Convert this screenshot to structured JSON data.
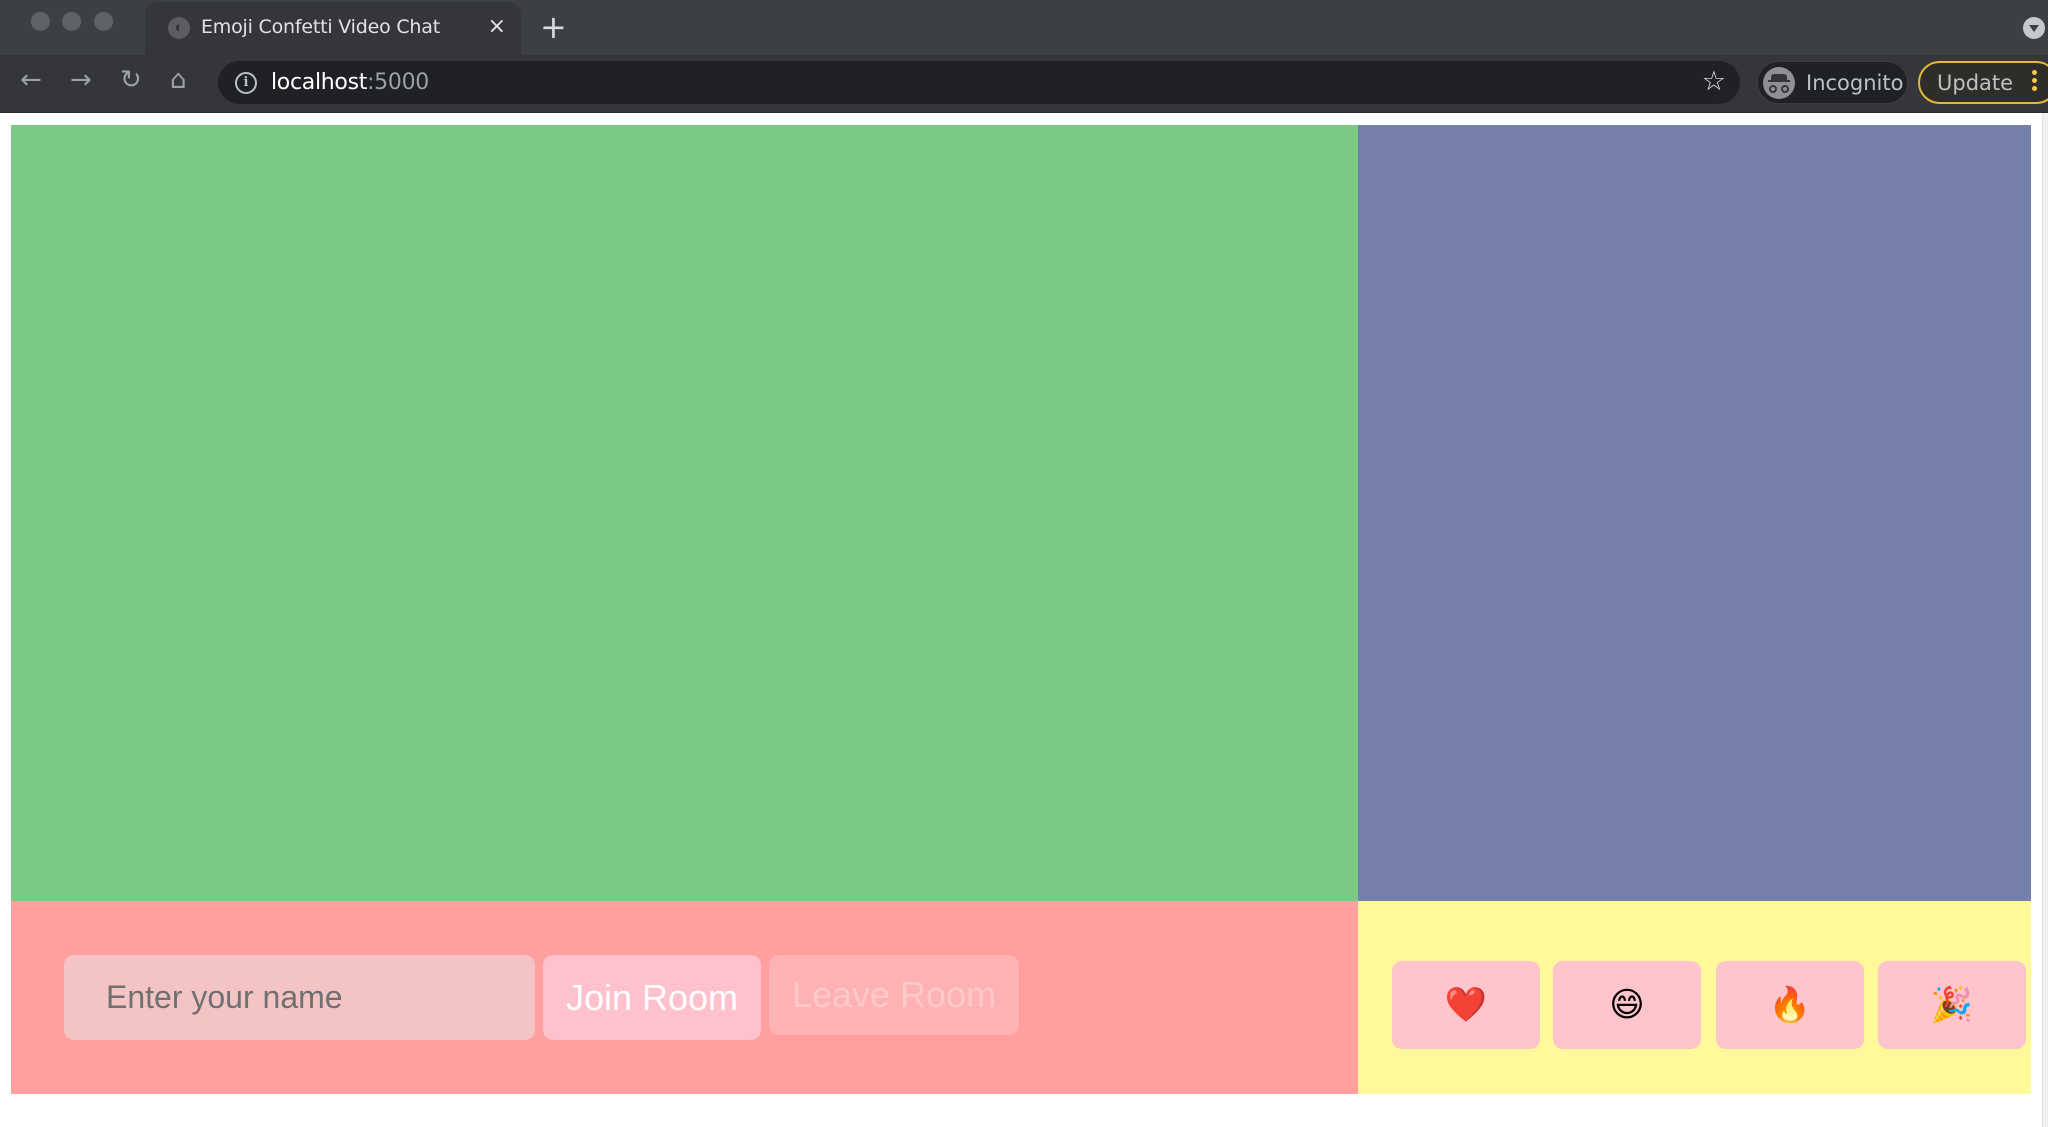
{
  "browser": {
    "tab_title": "Emoji Confetti Video Chat",
    "tab_close_icon": "×",
    "new_tab_icon": "+",
    "url_host": "localhost",
    "url_port": ":5000",
    "nav": {
      "back": "←",
      "forward": "→",
      "reload": "↻",
      "home": "⌂"
    },
    "star_icon": "☆",
    "info_icon": "i",
    "incognito_label": "Incognito",
    "update_label": "Update"
  },
  "colors": {
    "local_video": "#7cc983",
    "remote_video": "#7480ab",
    "controls_bg": "#ff9f9e",
    "reactions_bg": "#fff99b",
    "emoji_button": "#ffc4cc"
  },
  "controls": {
    "name_input": {
      "placeholder": "Enter your name",
      "value": ""
    },
    "join_label": "Join Room",
    "leave_label": "Leave Room"
  },
  "reactions": [
    {
      "name": "heart",
      "emoji": "❤️"
    },
    {
      "name": "grin",
      "emoji": "😄"
    },
    {
      "name": "fire",
      "emoji": "🔥"
    },
    {
      "name": "party-popper",
      "emoji": "🎉"
    }
  ]
}
